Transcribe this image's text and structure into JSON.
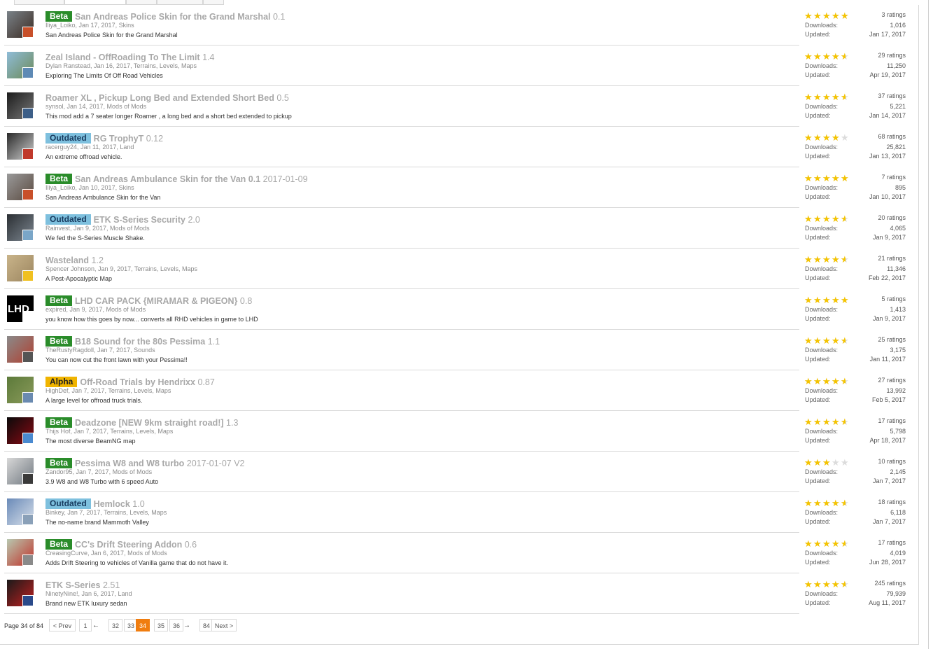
{
  "colors": {
    "beta": "#2a8c2a",
    "outdated": "#7ec0de",
    "alpha": "#f0b400",
    "star": "#f5c400",
    "current_page": "#f07d0f"
  },
  "labels": {
    "downloads": "Downloads:",
    "updated": "Updated:"
  },
  "resources": [
    {
      "badge": "Beta",
      "badge_type": "beta",
      "title": "San Andreas Police Skin for the Grand Marshal",
      "version": "0.1",
      "meta": "Iliya_Loiko, Jan 17, 2017, Skins",
      "description": "San Andreas Police Skin for the Grand Marshal",
      "rating": 5,
      "ratings": "3 ratings",
      "downloads": "1,016",
      "updated": "Jan 17, 2017",
      "thumb_colors": [
        "#7a8288",
        "#3a2a22"
      ],
      "avatar_color": "#c8502a"
    },
    {
      "badge": "",
      "badge_type": "",
      "title": "Zeal Island - OffRoading To The Limit",
      "version": "1.4",
      "meta": "Dylan Ranstead, Jan 16, 2017, Terrains, Levels, Maps",
      "description": "Exploring The Limits Of Off Road Vehicles",
      "rating": 4.5,
      "ratings": "29 ratings",
      "downloads": "11,250",
      "updated": "Apr 19, 2017",
      "thumb_colors": [
        "#8fbcd8",
        "#6c8a58"
      ],
      "avatar_color": "#5e8ab5"
    },
    {
      "badge": "",
      "badge_type": "",
      "title": "Roamer XL , Pickup Long Bed and Extended Short Bed",
      "version": "0.5",
      "meta": "synsol, Jan 14, 2017, Mods of Mods",
      "description": "This mod add a 7 seater longer Roamer , a long bed and a short bed extended to pickup",
      "rating": 4.5,
      "ratings": "37 ratings",
      "downloads": "5,221",
      "updated": "Jan 14, 2017",
      "thumb_colors": [
        "#1c1c1c",
        "#777777"
      ],
      "avatar_color": "#3d5f88"
    },
    {
      "badge": "Outdated",
      "badge_type": "outdated",
      "title": "RG TrophyT",
      "version": "0.12",
      "meta": "racerguy24, Jan 11, 2017, Land",
      "description": "An extreme offroad vehicle.",
      "rating": 4,
      "ratings": "68 ratings",
      "downloads": "25,821",
      "updated": "Jan 13, 2017",
      "thumb_colors": [
        "#2a2a2a",
        "#cfcfcf"
      ],
      "avatar_color": "#c0392b"
    },
    {
      "badge": "Beta",
      "badge_type": "beta",
      "title": "San Andreas Ambulance Skin for the Van 0.1",
      "version": "2017-01-09",
      "meta": "Iliya_Loiko, Jan 10, 2017, Skins",
      "description": "San Andreas Ambulance Skin for the Van",
      "rating": 5,
      "ratings": "7 ratings",
      "downloads": "895",
      "updated": "Jan 10, 2017",
      "thumb_colors": [
        "#9a9a9a",
        "#5a4a40"
      ],
      "avatar_color": "#c8502a"
    },
    {
      "badge": "Outdated",
      "badge_type": "outdated",
      "title": "ETK S-Series Security",
      "version": "2.0",
      "meta": "Rainvest, Jan 9, 2017, Mods of Mods",
      "description": "We fed the S-Series Muscle Shake.",
      "rating": 4.5,
      "ratings": "20 ratings",
      "downloads": "4,065",
      "updated": "Jan 9, 2017",
      "thumb_colors": [
        "#2b2f33",
        "#7c8690"
      ],
      "avatar_color": "#7aa6c8"
    },
    {
      "badge": "",
      "badge_type": "",
      "title": "Wasteland",
      "version": "1.2",
      "meta": "Spencer Johnson, Jan 9, 2017, Terrains, Levels, Maps",
      "description": "A Post-Apocalyptic Map",
      "rating": 4.5,
      "ratings": "21 ratings",
      "downloads": "11,346",
      "updated": "Feb 22, 2017",
      "thumb_colors": [
        "#c9b48a",
        "#9c8660"
      ],
      "avatar_color": "#f0c020"
    },
    {
      "badge": "Beta",
      "badge_type": "beta",
      "title": "LHD CAR PACK {MIRAMAR & PIGEON}",
      "version": "0.8",
      "meta": "expired, Jan 9, 2017, Mods of Mods",
      "description": "you know how this goes by now... converts all RHD vehicles in game to LHD",
      "rating": 5,
      "ratings": "5 ratings",
      "downloads": "1,413",
      "updated": "Jan 9, 2017",
      "thumb_colors": [
        "#000000",
        "#000000"
      ],
      "thumb_text": "LHD",
      "avatar_color": "#ffffff"
    },
    {
      "badge": "Beta",
      "badge_type": "beta",
      "title": "B18 Sound for the 80s Pessima",
      "version": "1.1",
      "meta": "TheRustyRagdoll, Jan 7, 2017, Sounds",
      "description": "You can now cut the front lawn with your Pessima!!",
      "rating": 4.5,
      "ratings": "25 ratings",
      "downloads": "3,175",
      "updated": "Jan 11, 2017",
      "thumb_colors": [
        "#8a8a8a",
        "#b04030"
      ],
      "avatar_color": "#555555"
    },
    {
      "badge": "Alpha",
      "badge_type": "alpha",
      "title": "Off-Road Trials by Hendrixx",
      "version": "0.87",
      "meta": "HighDef, Jan 7, 2017, Terrains, Levels, Maps",
      "description": "A large level for offroad truck trials.",
      "rating": 4.5,
      "ratings": "27 ratings",
      "downloads": "13,992",
      "updated": "Feb 5, 2017",
      "thumb_colors": [
        "#5c7a3a",
        "#8a9a5a"
      ],
      "avatar_color": "#6a8ab0"
    },
    {
      "badge": "Beta",
      "badge_type": "beta",
      "title": "Deadzone [NEW 9km straight road!]",
      "version": "1.3",
      "meta": "Thijs Hof, Jan 7, 2017, Terrains, Levels, Maps",
      "description": "The most diverse BeamNG map",
      "rating": 4.5,
      "ratings": "17 ratings",
      "downloads": "5,798",
      "updated": "Apr 18, 2017",
      "thumb_colors": [
        "#0a0a0a",
        "#8a0a14"
      ],
      "avatar_color": "#4a8ad0"
    },
    {
      "badge": "Beta",
      "badge_type": "beta",
      "title": "Pessima W8 and W8 turbo",
      "version": "2017-01-07 V2",
      "meta": "Zandor95, Jan 7, 2017, Mods of Mods",
      "description": "3.9 W8 and W8 Turbo with 6 speed Auto",
      "rating": 3,
      "ratings": "10 ratings",
      "downloads": "2,145",
      "updated": "Jan 7, 2017",
      "thumb_colors": [
        "#d8d8d8",
        "#707880"
      ],
      "avatar_color": "#3a3a3a"
    },
    {
      "badge": "Outdated",
      "badge_type": "outdated",
      "title": "Hemlock",
      "version": "1.0",
      "meta": "Binkey, Jan 7, 2017, Terrains, Levels, Maps",
      "description": "The no-name brand Mammoth Valley",
      "rating": 4.5,
      "ratings": "18 ratings",
      "downloads": "6,118",
      "updated": "Jan 7, 2017",
      "thumb_colors": [
        "#6a8ab8",
        "#d8e0ea"
      ],
      "avatar_color": "#8aa0b8"
    },
    {
      "badge": "Beta",
      "badge_type": "beta",
      "title": "CC's Drift Steering Addon",
      "version": "0.6",
      "meta": "CreasingCurve, Jan 6, 2017, Mods of Mods",
      "description": "Adds Drift Steering to vehicles of Vanilla game that do not have it.",
      "rating": 4.5,
      "ratings": "17 ratings",
      "downloads": "4,019",
      "updated": "Jun 28, 2017",
      "thumb_colors": [
        "#b8c8b0",
        "#c03028"
      ],
      "avatar_color": "#8a8a8a"
    },
    {
      "badge": "",
      "badge_type": "",
      "title": "ETK S-Series",
      "version": "2.51",
      "meta": "NinetyNine!, Jan 6, 2017, Land",
      "description": "Brand new ETK luxury sedan",
      "rating": 4.5,
      "ratings": "245 ratings",
      "downloads": "79,939",
      "updated": "Aug 11, 2017",
      "thumb_colors": [
        "#1a1a1a",
        "#c02020"
      ],
      "avatar_color": "#2a4a8a"
    }
  ],
  "pagination": {
    "label": "Page 34 of 84",
    "prev": "< Prev",
    "next": "Next >",
    "pages": [
      "1",
      "32",
      "33",
      "34",
      "35",
      "36",
      "84"
    ],
    "current": "34",
    "gap": "→",
    "gap_left": "←"
  }
}
